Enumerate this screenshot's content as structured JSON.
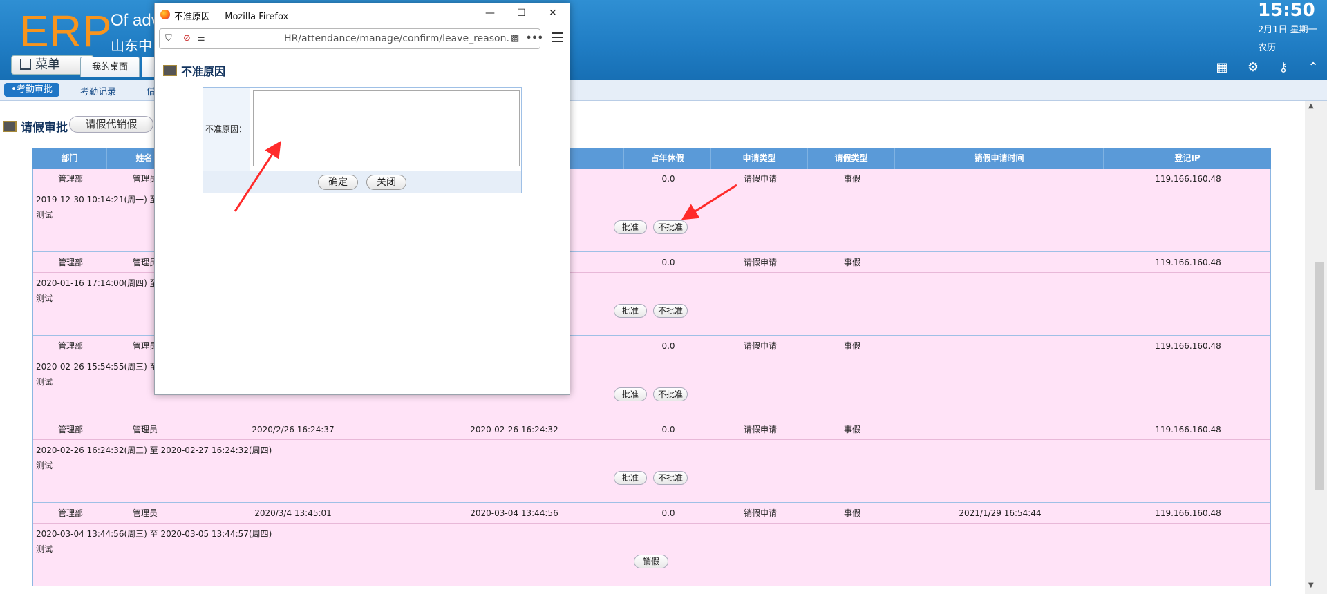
{
  "header": {
    "logo": "ERP",
    "slogan_line1": "Of adv",
    "slogan_line2": "山东中",
    "menu_label": "菜单",
    "desk_tab": "我的桌面",
    "time": "15:50",
    "date": "2月1日 星期一",
    "lunar": "农历",
    "icons": [
      "apps-icon",
      "gear-icon",
      "key-icon",
      "collapse-icon"
    ]
  },
  "subtabs": {
    "active": "•考勤审批",
    "records": "考勤记录",
    "third": "借"
  },
  "page": {
    "title": "请假审批",
    "proxy_button": "请假代销假"
  },
  "table": {
    "headers": {
      "dept": "部门",
      "name": "姓名",
      "annual": "占年休假",
      "apply_type": "申请类型",
      "leave_type": "请假类型",
      "cancel_time": "销假申请时间",
      "ip": "登记IP"
    },
    "rows": [
      {
        "dept": "管理部",
        "name": "管理员",
        "submit": "",
        "start": "",
        "annual": "0.0",
        "apply_type": "请假申请",
        "leave_type": "事假",
        "cancel_time": "",
        "ip": "119.166.160.48",
        "range": "2019-12-30 10:14:21(周一) 至 2",
        "reason": "测试",
        "btn1": "批准",
        "btn2": "不批准"
      },
      {
        "dept": "管理部",
        "name": "管理员",
        "submit": "",
        "start": "",
        "annual": "0.0",
        "apply_type": "请假申请",
        "leave_type": "事假",
        "cancel_time": "",
        "ip": "119.166.160.48",
        "range": "2020-01-16 17:14:00(周四) 至 2",
        "reason": "测试",
        "btn1": "批准",
        "btn2": "不批准"
      },
      {
        "dept": "管理部",
        "name": "管理员",
        "submit": "",
        "start": "",
        "annual": "0.0",
        "apply_type": "请假申请",
        "leave_type": "事假",
        "cancel_time": "",
        "ip": "119.166.160.48",
        "range": "2020-02-26 15:54:55(周三) 至 2",
        "reason": "测试",
        "btn1": "批准",
        "btn2": "不批准"
      },
      {
        "dept": "管理部",
        "name": "管理员",
        "submit": "2020/2/26 16:24:37",
        "start": "2020-02-26 16:24:32",
        "annual": "0.0",
        "apply_type": "请假申请",
        "leave_type": "事假",
        "cancel_time": "",
        "ip": "119.166.160.48",
        "range": "2020-02-26 16:24:32(周三) 至 2020-02-27 16:24:32(周四)",
        "reason": "测试",
        "btn1": "批准",
        "btn2": "不批准"
      },
      {
        "dept": "管理部",
        "name": "管理员",
        "submit": "2020/3/4 13:45:01",
        "start": "2020-03-04 13:44:56",
        "annual": "0.0",
        "apply_type": "销假申请",
        "leave_type": "事假",
        "cancel_time": "2021/1/29 16:54:44",
        "ip": "119.166.160.48",
        "range": "2020-03-04 13:44:56(周三) 至 2020-03-05 13:44:57(周四)",
        "reason": "测试",
        "btn1": "销假",
        "btn2": ""
      }
    ]
  },
  "popup": {
    "window_title": "不准原因 — Mozilla Firefox",
    "url": "HR/attendance/manage/confirm/leave_reason.",
    "dialog_title": "不准原因",
    "field_label": "不准原因：",
    "textarea_value": "",
    "confirm_button": "确定",
    "close_button": "关闭"
  },
  "colors": {
    "header_blue": "#1f7cc3",
    "logo_orange": "#f7941d",
    "row_pink": "#ffe3f7",
    "table_head": "#5a9ad8",
    "arrow_red": "#ff2a2a"
  }
}
